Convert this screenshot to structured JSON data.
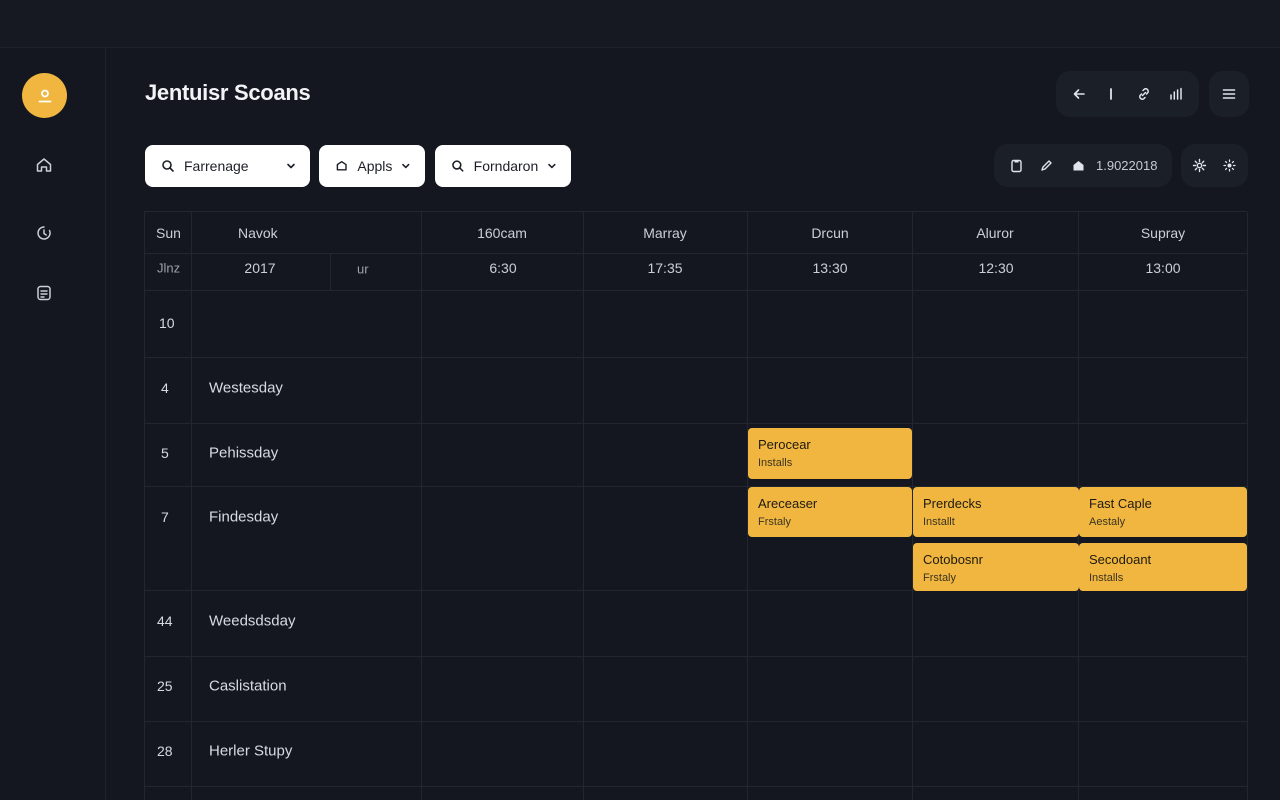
{
  "app": {
    "title": "Jentuisr Scoans"
  },
  "colors": {
    "background": "#141720",
    "accent": "#f0b63f",
    "panel": "#1b1f28",
    "text": "#d9dde6"
  },
  "sidebar": {
    "avatar_icon": "user-icon",
    "items": [
      {
        "name": "home",
        "icon": "home-icon"
      },
      {
        "name": "history",
        "icon": "clock-icon"
      },
      {
        "name": "notes",
        "icon": "document-icon"
      }
    ]
  },
  "toolbar": {
    "icons": [
      "back-arrow-icon",
      "cursor-icon",
      "link-icon",
      "bar-chart-icon"
    ],
    "menu_icon": "menu-icon"
  },
  "filters": [
    {
      "label": "Farrenage",
      "icon": "search-icon"
    },
    {
      "label": "Appls",
      "icon": "tag-icon"
    },
    {
      "label": "Forndaron",
      "icon": "search-icon"
    }
  ],
  "actions": {
    "date_label": "1.9022018",
    "icons": [
      "clipboard-icon",
      "pencil-icon",
      "home-icon"
    ],
    "extra_icons": [
      "settings-icon",
      "sun-icon"
    ]
  },
  "calendar": {
    "header_cols": [
      "Sun",
      "Navok",
      "160cam",
      "Marray",
      "Drcun",
      "Aluror",
      "Supray"
    ],
    "subheader": [
      "Jlnz",
      "2017",
      "ur",
      "6:30",
      "17:35",
      "13:30",
      "12:30",
      "13:00"
    ],
    "rows": [
      {
        "num": "10",
        "label": ""
      },
      {
        "num": "4",
        "label": "Westesday"
      },
      {
        "num": "5",
        "label": "Pehissday"
      },
      {
        "num": "7",
        "label": "Findesday"
      },
      {
        "num": "44",
        "label": "Weedsdsday"
      },
      {
        "num": "25",
        "label": "Caslistation"
      },
      {
        "num": "28",
        "label": "Herler Stupy"
      }
    ],
    "events": [
      {
        "title": "Perocear",
        "subtitle": "Installs"
      },
      {
        "title": "Areceaser",
        "subtitle": "Frstaly"
      },
      {
        "title": "Prerdecks",
        "subtitle": "Installt"
      },
      {
        "title": "Fast Caple",
        "subtitle": "Aestaly"
      },
      {
        "title": "Cotobosnr",
        "subtitle": "Frstaly"
      },
      {
        "title": "Secodoant",
        "subtitle": "Installs"
      }
    ]
  }
}
